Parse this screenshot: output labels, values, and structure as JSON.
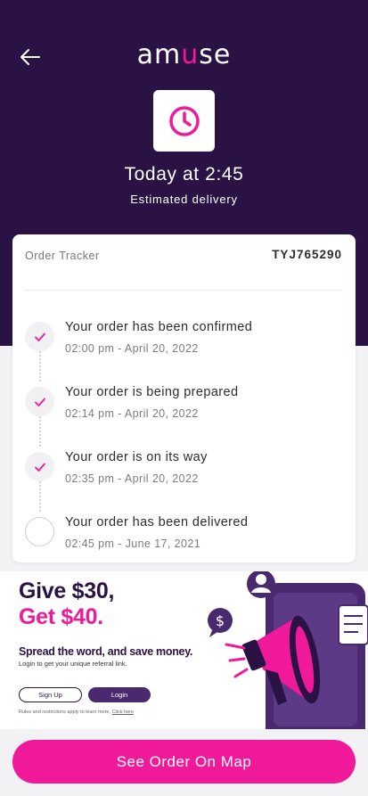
{
  "header": {
    "back_icon": "arrow-left-icon",
    "logo_text": "amuse",
    "status_icon": "clock-icon",
    "eta_title": "Today at 2:45",
    "eta_subtitle": "Estimated delivery"
  },
  "tracker": {
    "label": "Order Tracker",
    "order_id": "TYJ765290",
    "steps": [
      {
        "title": "Your order has been confirmed",
        "time": "02:00 pm - April 20, 2022",
        "done": true
      },
      {
        "title": "Your order is being prepared",
        "time": "02:14 pm - April 20, 2022",
        "done": true
      },
      {
        "title": "Your order is on its way",
        "time": "02:35 pm - April 20, 2022",
        "done": true
      },
      {
        "title": "Your order has been delivered",
        "time": "02:45 pm - June 17, 2021",
        "done": false
      }
    ]
  },
  "promo": {
    "line1": "Give $30,",
    "line2": "Get $40.",
    "subtitle": "Spread the word, and save money.",
    "note": "Login to get your unique referral link.",
    "signup_label": "Sign Up",
    "login_label": "Login",
    "rules_text": "Rules and restrictions apply to learn more,",
    "rules_link": "Click here",
    "art_icons": [
      "megaphone-icon",
      "dollar-chat-icon",
      "user-icon",
      "phone-icon"
    ]
  },
  "footer": {
    "map_button_label": "See Order On Map"
  },
  "colors": {
    "header_bg": "#2a1245",
    "accent": "#f0199a",
    "page_bg": "#f2f2f4"
  }
}
